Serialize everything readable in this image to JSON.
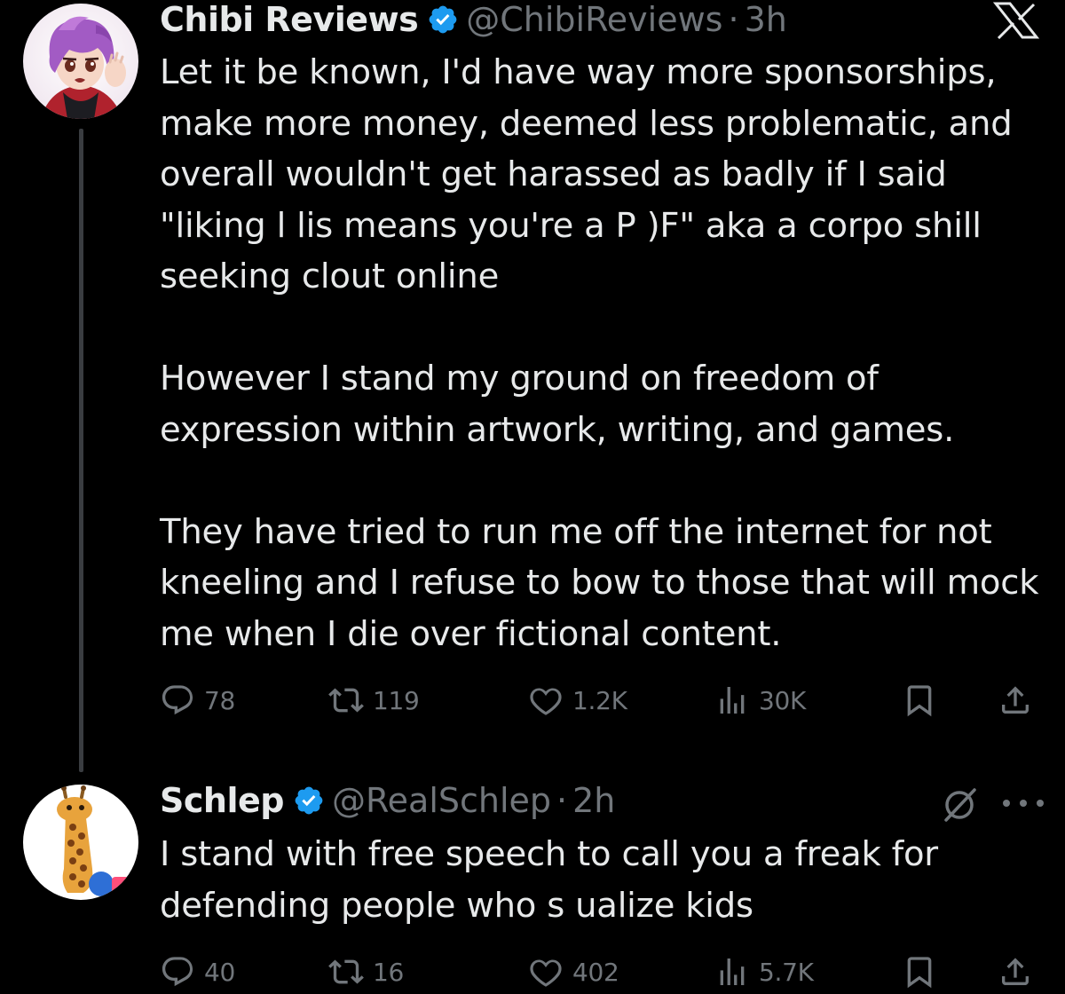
{
  "colors": {
    "background": "#000000",
    "text_primary": "#e7e9ea",
    "text_secondary": "#71767b",
    "verified_badge": "#1d9bf0",
    "thread_line": "#3a3d41"
  },
  "tweets": [
    {
      "display_name": "Chibi Reviews",
      "handle": "@ChibiReviews",
      "separator": "·",
      "time": "3h",
      "verified": true,
      "avatar_icon": "anime-character-avatar",
      "paragraphs": [
        "Let it be known, I'd have way more sponsorships, make more money, deemed less problematic, and overall wouldn't get harassed as badly if I said \"liking l   lis means you're a P  )F\" aka a corpo shill seeking clout online",
        "However I stand my ground on freedom of expression within artwork, writing, and games.",
        "They have tried to run me off the internet for not kneeling and I refuse to bow to those that will mock me when I die over fictional content."
      ],
      "actions": {
        "replies": "78",
        "reposts": "119",
        "likes": "1.2K",
        "views": "30K"
      }
    },
    {
      "display_name": "Schlep",
      "handle": "@RealSchlep",
      "separator": "·",
      "time": "2h",
      "verified": true,
      "avatar_icon": "giraffe-avatar",
      "paragraphs": [
        "I stand with free speech to call you a freak for defending people who s    ualize kids"
      ],
      "actions": {
        "replies": "40",
        "reposts": "16",
        "likes": "402",
        "views": "5.7K"
      }
    }
  ],
  "icons": {
    "reply": "reply-icon",
    "repost": "repost-icon",
    "like": "heart-icon",
    "views": "views-icon",
    "bookmark": "bookmark-icon",
    "share": "share-icon",
    "x_logo": "x-logo-icon",
    "grok": "grok-icon",
    "more": "more-icon"
  }
}
